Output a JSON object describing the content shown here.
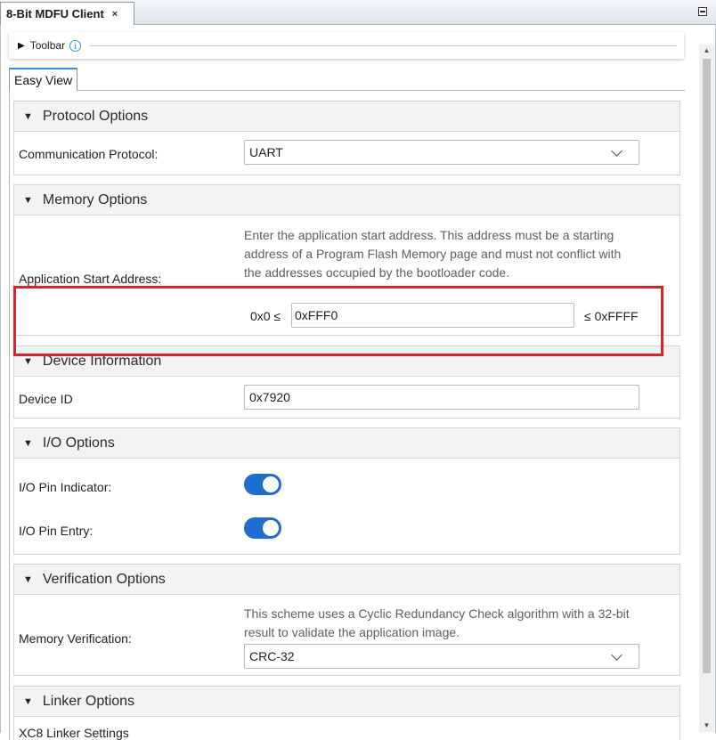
{
  "tab": {
    "title": "8-Bit MDFU Client",
    "close": "×"
  },
  "toolbar": {
    "label": "Toolbar",
    "info": "i"
  },
  "view_tab": "Easy View",
  "protocol": {
    "title": "Protocol Options",
    "comm_label": "Communication Protocol:",
    "comm_value": "UART"
  },
  "memory": {
    "title": "Memory Options",
    "help": "Enter the application start address. This address must be a starting address of a Program Flash Memory page and must not conflict with the addresses occupied by the bootloader code.",
    "addr_label": "Application Start Address:",
    "min": "0x0 ≤",
    "value": "0xFFF0",
    "max": "≤ 0xFFFF"
  },
  "device": {
    "title": "Device Information",
    "id_label": "Device ID",
    "id_value": "0x7920"
  },
  "io": {
    "title": "I/O Options",
    "indicator_label": "I/O Pin Indicator:",
    "indicator_on": true,
    "entry_label": "I/O Pin Entry:",
    "entry_on": true
  },
  "verification": {
    "title": "Verification Options",
    "help": "This scheme uses a Cyclic Redundancy Check algorithm with a 32-bit result to validate the application image.",
    "label": "Memory Verification:",
    "value": "CRC-32"
  },
  "linker": {
    "title": "Linker Options",
    "partial_label": "XC8 Linker Settings"
  },
  "colors": {
    "accent": "#1f6fd1",
    "highlight": "#e0202a"
  }
}
